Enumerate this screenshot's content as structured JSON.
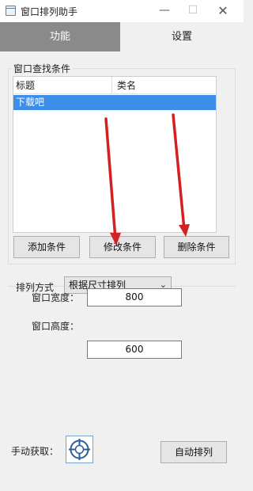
{
  "window": {
    "title": "窗口排列助手",
    "min_label": "—",
    "max_label": "☐",
    "close_label": "✕"
  },
  "tabs": [
    {
      "label": "功能",
      "active": true
    },
    {
      "label": "设置",
      "active": false
    }
  ],
  "search_group": {
    "title": "窗口查找条件",
    "columns": [
      "标题",
      "类名"
    ],
    "rows": [
      {
        "title": "下载吧",
        "class": "",
        "selected": true
      }
    ],
    "buttons": {
      "add": "添加条件",
      "modify": "修改条件",
      "delete": "删除条件"
    }
  },
  "arrange_group": {
    "mode_label": "排列方式",
    "mode_value": "根据尺寸排列",
    "width_label": "窗口宽度：",
    "width_value": "800",
    "height_label": "窗口高度：",
    "height_value": "600"
  },
  "bottom": {
    "manual_label": "手动获取：",
    "auto_button": "自动排列"
  },
  "colors": {
    "active_tab": "#8a8a8a",
    "selection": "#3e8ee9",
    "annotation_arrow": "#d42020"
  },
  "icons": {
    "app": "window-icon",
    "target": "crosshair-target-icon",
    "dropdown": "chevron-down-icon"
  }
}
